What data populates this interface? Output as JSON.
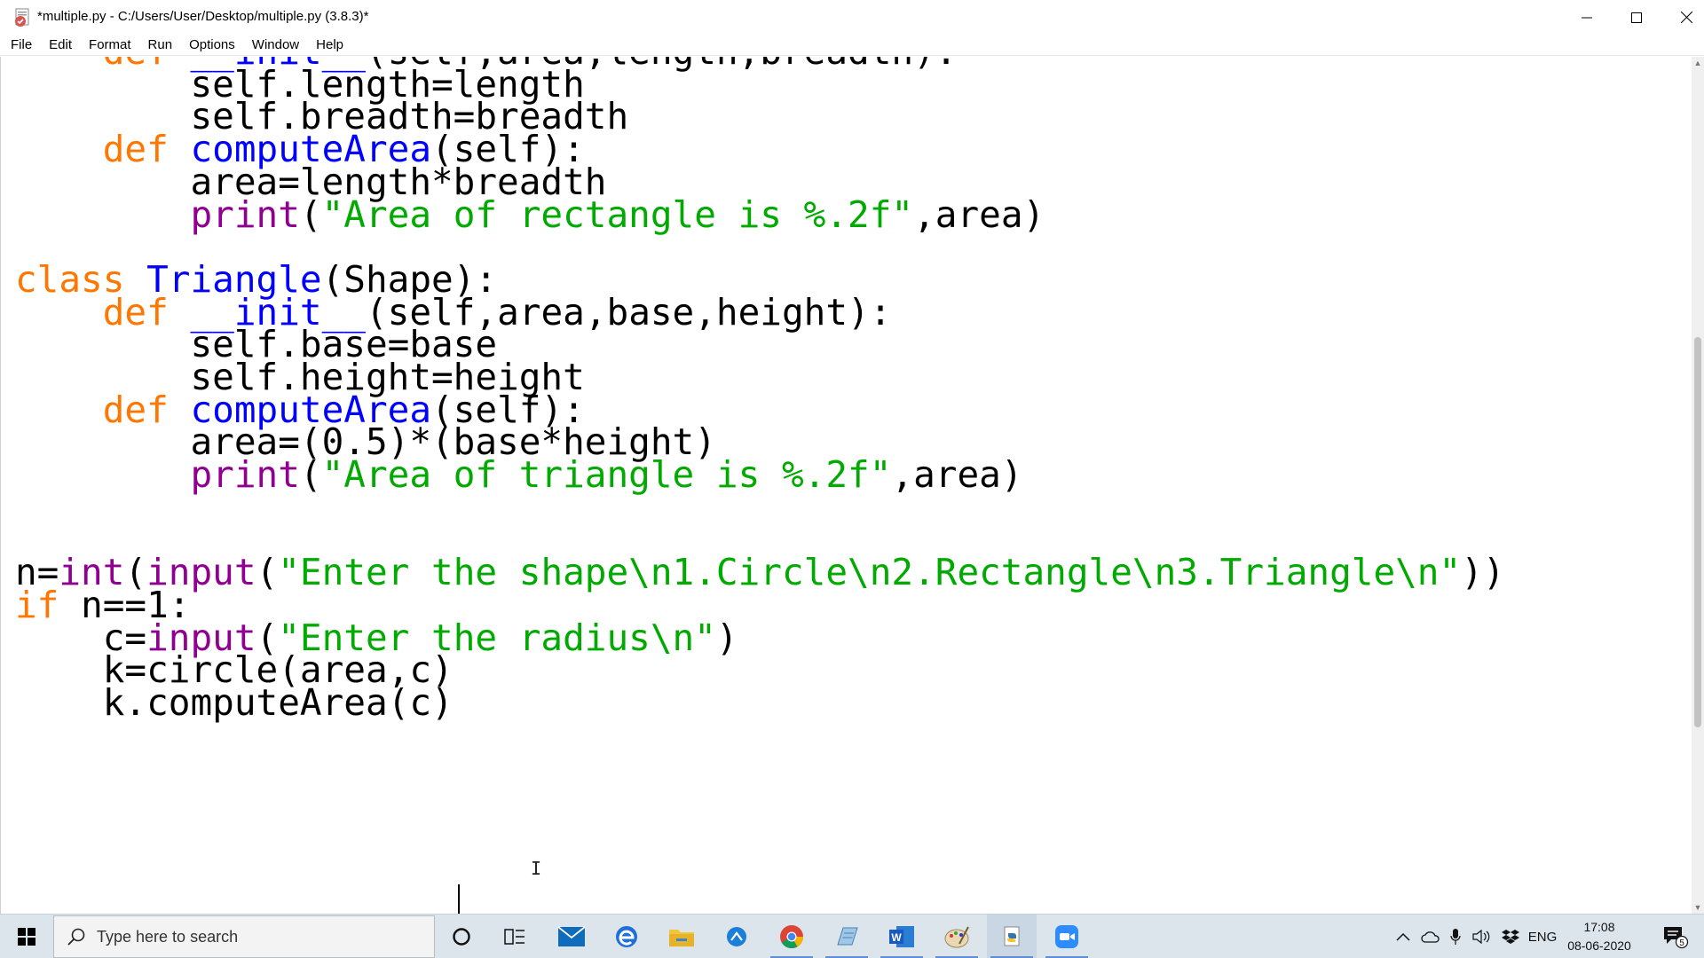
{
  "window": {
    "title": "*multiple.py - C:/Users/User/Desktop/multiple.py (3.8.3)*",
    "minimize_icon": "minimize-icon",
    "maximize_icon": "maximize-icon",
    "close_icon": "close-icon"
  },
  "menu": [
    "File",
    "Edit",
    "Format",
    "Run",
    "Options",
    "Window",
    "Help"
  ],
  "editor": {
    "colors": {
      "keyword": "#ff7700",
      "definition": "#0000ff",
      "builtin": "#900090",
      "string": "#00aa00",
      "text": "#000000"
    },
    "lines": [
      [
        [
          "kw",
          "    def "
        ],
        [
          "df",
          "__init__"
        ],
        [
          "pl",
          "(self,area,length,breadth):"
        ]
      ],
      [
        [
          "pl",
          "        self.length=length"
        ]
      ],
      [
        [
          "pl",
          "        self.breadth=breadth"
        ]
      ],
      [
        [
          "pl",
          "    "
        ],
        [
          "kw",
          "def "
        ],
        [
          "df",
          "computeArea"
        ],
        [
          "pl",
          "(self):"
        ]
      ],
      [
        [
          "pl",
          "        area=length*breadth"
        ]
      ],
      [
        [
          "pl",
          "        "
        ],
        [
          "bi",
          "print"
        ],
        [
          "pl",
          "("
        ],
        [
          "st",
          "\"Area of rectangle is %.2f\""
        ],
        [
          "pl",
          ",area)"
        ]
      ],
      [],
      [
        [
          "kw",
          "class "
        ],
        [
          "df",
          "Triangle"
        ],
        [
          "pl",
          "(Shape):"
        ]
      ],
      [
        [
          "pl",
          "    "
        ],
        [
          "kw",
          "def "
        ],
        [
          "df",
          "__init__"
        ],
        [
          "pl",
          "(self,area,base,height):"
        ]
      ],
      [
        [
          "pl",
          "        self.base=base"
        ]
      ],
      [
        [
          "pl",
          "        self.height=height"
        ]
      ],
      [
        [
          "pl",
          "    "
        ],
        [
          "kw",
          "def "
        ],
        [
          "df",
          "computeArea"
        ],
        [
          "pl",
          "(self):"
        ]
      ],
      [
        [
          "pl",
          "        area=(0.5)*(base*height)"
        ]
      ],
      [
        [
          "pl",
          "        "
        ],
        [
          "bi",
          "print"
        ],
        [
          "pl",
          "("
        ],
        [
          "st",
          "\"Area of triangle is %.2f\""
        ],
        [
          "pl",
          ",area)"
        ]
      ],
      [],
      [],
      [
        [
          "pl",
          "n="
        ],
        [
          "bi",
          "int"
        ],
        [
          "pl",
          "("
        ],
        [
          "bi",
          "input"
        ],
        [
          "pl",
          "("
        ],
        [
          "st",
          "\"Enter the shape\\n1.Circle\\n2.Rectangle\\n3.Triangle\\n\""
        ],
        [
          "pl",
          "))"
        ]
      ],
      [
        [
          "kw",
          "if "
        ],
        [
          "pl",
          "n==1:"
        ]
      ],
      [
        [
          "pl",
          "    c="
        ],
        [
          "bi",
          "input"
        ],
        [
          "pl",
          "("
        ],
        [
          "st",
          "\"Enter the radius\\n\""
        ],
        [
          "pl",
          ")"
        ]
      ],
      [
        [
          "pl",
          "    k=circle(area,c)"
        ]
      ],
      [
        [
          "pl",
          "    k.computeArea(c)"
        ]
      ]
    ]
  },
  "taskbar": {
    "start_icon": "windows-start-icon",
    "search_placeholder": "Type here to search",
    "apps": [
      {
        "name": "cortana-icon"
      },
      {
        "name": "task-view-icon"
      },
      {
        "name": "mail-icon"
      },
      {
        "name": "edge-icon"
      },
      {
        "name": "file-explorer-icon"
      },
      {
        "name": "app-icon"
      },
      {
        "name": "chrome-icon"
      },
      {
        "name": "notepad-icon"
      },
      {
        "name": "word-icon"
      },
      {
        "name": "paint-icon"
      },
      {
        "name": "python-idle-icon"
      },
      {
        "name": "zoom-icon"
      }
    ],
    "tray": {
      "language": "ENG",
      "time": "17:08",
      "date": "08-06-2020",
      "notification_count": "5"
    }
  }
}
